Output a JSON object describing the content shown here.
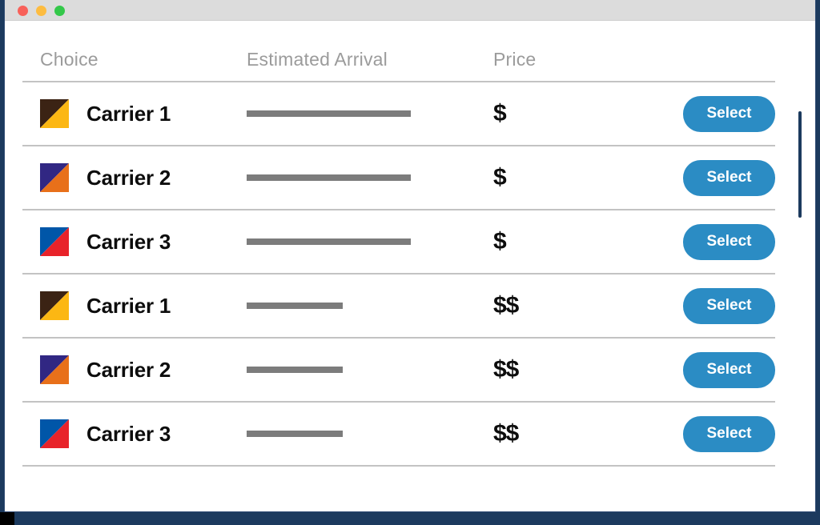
{
  "window": {
    "titlebar": {
      "lights": [
        {
          "name": "close",
          "color": "#f8615a"
        },
        {
          "name": "minimize",
          "color": "#fdbc40"
        },
        {
          "name": "maximize",
          "color": "#34c84a"
        }
      ]
    }
  },
  "table": {
    "headers": {
      "choice": "Choice",
      "arrival": "Estimated Arrival",
      "price": "Price"
    },
    "action_label": "Select",
    "rows": [
      {
        "carrier": "Carrier 1",
        "logo": {
          "top_color": "#3b2314",
          "bottom_color": "#fcb713"
        },
        "arrival_bar_width": 205,
        "price": "$",
        "action": "Select"
      },
      {
        "carrier": "Carrier 2",
        "logo": {
          "top_color": "#312783",
          "bottom_color": "#e8701a"
        },
        "arrival_bar_width": 205,
        "price": "$",
        "action": "Select"
      },
      {
        "carrier": "Carrier 3",
        "logo": {
          "top_color": "#0056a8",
          "bottom_color": "#e8232a"
        },
        "arrival_bar_width": 205,
        "price": "$",
        "action": "Select"
      },
      {
        "carrier": "Carrier 1",
        "logo": {
          "top_color": "#3b2314",
          "bottom_color": "#fcb713"
        },
        "arrival_bar_width": 120,
        "price": "$$",
        "action": "Select"
      },
      {
        "carrier": "Carrier 2",
        "logo": {
          "top_color": "#312783",
          "bottom_color": "#e8701a"
        },
        "arrival_bar_width": 120,
        "price": "$$",
        "action": "Select"
      },
      {
        "carrier": "Carrier 3",
        "logo": {
          "top_color": "#0056a8",
          "bottom_color": "#e8232a"
        },
        "arrival_bar_width": 120,
        "price": "$$",
        "action": "Select"
      }
    ]
  },
  "colors": {
    "accent": "#2b8cc4",
    "frame": "#1c3a5e",
    "titlebar": "#dcdcdc",
    "divider": "#c3c3c3",
    "header_text": "#9b9b9b",
    "bar": "#7c7c7c"
  },
  "scrollbar": {
    "orientation": "vertical",
    "thumb_color": "#1c3a5e"
  }
}
